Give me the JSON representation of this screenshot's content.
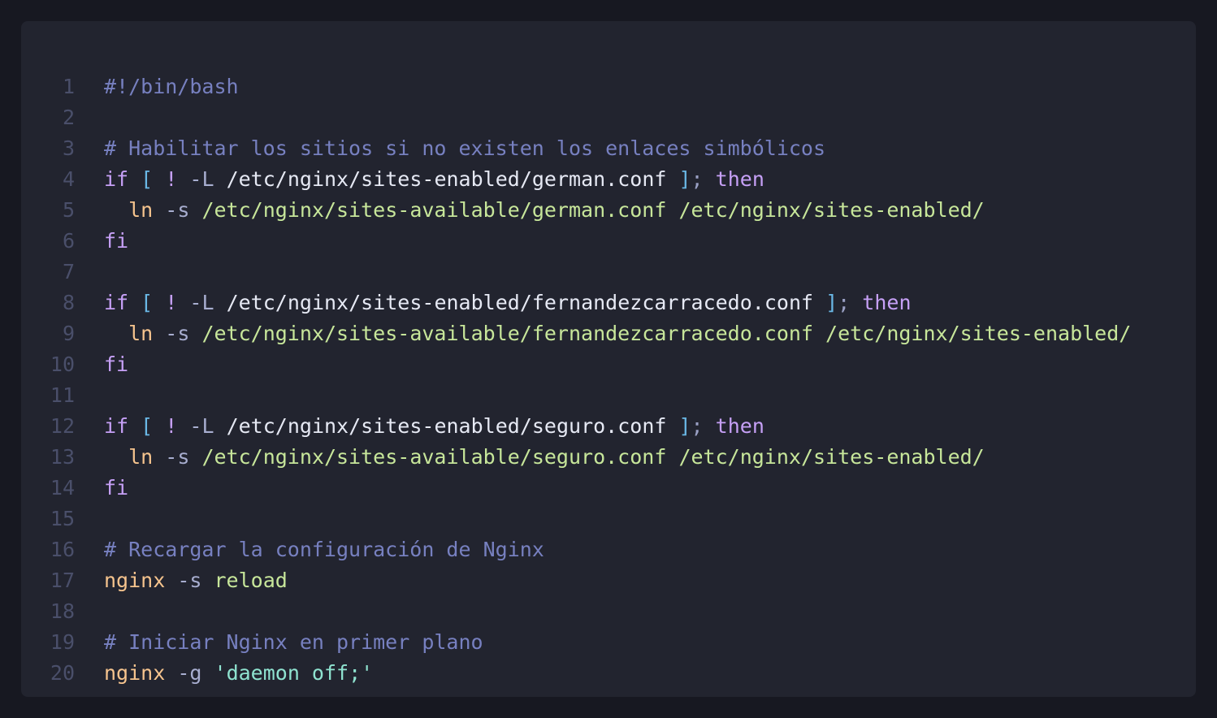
{
  "editor": {
    "language": "bash",
    "colors": {
      "background": "#22242f",
      "page": "#171821",
      "line_number": "#4a4f6a",
      "comment": "#7780c0",
      "keyword": "#c6a0f6",
      "bracket": "#6ab8e6",
      "command": "#f6c48e",
      "argument": "#c7e69a",
      "string": "#8fe3d0",
      "text": "#e6e9f4"
    },
    "lines": [
      {
        "n": "1",
        "tokens": [
          {
            "t": "#!/bin/bash",
            "c": "comment"
          }
        ]
      },
      {
        "n": "2",
        "tokens": []
      },
      {
        "n": "3",
        "tokens": [
          {
            "t": "# Habilitar los sitios si no existen los enlaces simbólicos",
            "c": "comment"
          }
        ]
      },
      {
        "n": "4",
        "tokens": [
          {
            "t": "if",
            "c": "keyword"
          },
          {
            "t": " ",
            "c": "path"
          },
          {
            "t": "[",
            "c": "bracket"
          },
          {
            "t": " ",
            "c": "path"
          },
          {
            "t": "!",
            "c": "keyword"
          },
          {
            "t": " ",
            "c": "path"
          },
          {
            "t": "-L",
            "c": "flag"
          },
          {
            "t": " /etc/nginx/sites-enabled/german.conf ",
            "c": "path"
          },
          {
            "t": "]",
            "c": "bracket"
          },
          {
            "t": ";",
            "c": "punct"
          },
          {
            "t": " ",
            "c": "path"
          },
          {
            "t": "then",
            "c": "keyword"
          }
        ]
      },
      {
        "n": "5",
        "tokens": [
          {
            "t": "  ",
            "c": "path"
          },
          {
            "t": "ln",
            "c": "cmd"
          },
          {
            "t": " ",
            "c": "path"
          },
          {
            "t": "-s",
            "c": "flag"
          },
          {
            "t": " /etc/nginx/sites-available/german.conf /etc/nginx/sites-enabled/",
            "c": "arg"
          }
        ]
      },
      {
        "n": "6",
        "tokens": [
          {
            "t": "fi",
            "c": "keyword"
          }
        ]
      },
      {
        "n": "7",
        "tokens": []
      },
      {
        "n": "8",
        "tokens": [
          {
            "t": "if",
            "c": "keyword"
          },
          {
            "t": " ",
            "c": "path"
          },
          {
            "t": "[",
            "c": "bracket"
          },
          {
            "t": " ",
            "c": "path"
          },
          {
            "t": "!",
            "c": "keyword"
          },
          {
            "t": " ",
            "c": "path"
          },
          {
            "t": "-L",
            "c": "flag"
          },
          {
            "t": " /etc/nginx/sites-enabled/fernandezcarracedo.conf ",
            "c": "path"
          },
          {
            "t": "]",
            "c": "bracket"
          },
          {
            "t": ";",
            "c": "punct"
          },
          {
            "t": " ",
            "c": "path"
          },
          {
            "t": "then",
            "c": "keyword"
          }
        ]
      },
      {
        "n": "9",
        "tokens": [
          {
            "t": "  ",
            "c": "path"
          },
          {
            "t": "ln",
            "c": "cmd"
          },
          {
            "t": " ",
            "c": "path"
          },
          {
            "t": "-s",
            "c": "flag"
          },
          {
            "t": " /etc/nginx/sites-available/fernandezcarracedo.conf /etc/nginx/sites-enabled/",
            "c": "arg"
          }
        ]
      },
      {
        "n": "10",
        "tokens": [
          {
            "t": "fi",
            "c": "keyword"
          }
        ]
      },
      {
        "n": "11",
        "tokens": []
      },
      {
        "n": "12",
        "tokens": [
          {
            "t": "if",
            "c": "keyword"
          },
          {
            "t": " ",
            "c": "path"
          },
          {
            "t": "[",
            "c": "bracket"
          },
          {
            "t": " ",
            "c": "path"
          },
          {
            "t": "!",
            "c": "keyword"
          },
          {
            "t": " ",
            "c": "path"
          },
          {
            "t": "-L",
            "c": "flag"
          },
          {
            "t": " /etc/nginx/sites-enabled/seguro.conf ",
            "c": "path"
          },
          {
            "t": "]",
            "c": "bracket"
          },
          {
            "t": ";",
            "c": "punct"
          },
          {
            "t": " ",
            "c": "path"
          },
          {
            "t": "then",
            "c": "keyword"
          }
        ]
      },
      {
        "n": "13",
        "tokens": [
          {
            "t": "  ",
            "c": "path"
          },
          {
            "t": "ln",
            "c": "cmd"
          },
          {
            "t": " ",
            "c": "path"
          },
          {
            "t": "-s",
            "c": "flag"
          },
          {
            "t": " /etc/nginx/sites-available/seguro.conf /etc/nginx/sites-enabled/",
            "c": "arg"
          }
        ]
      },
      {
        "n": "14",
        "tokens": [
          {
            "t": "fi",
            "c": "keyword"
          }
        ]
      },
      {
        "n": "15",
        "tokens": []
      },
      {
        "n": "16",
        "tokens": [
          {
            "t": "# Recargar la configuración de Nginx",
            "c": "comment"
          }
        ]
      },
      {
        "n": "17",
        "tokens": [
          {
            "t": "nginx",
            "c": "cmd"
          },
          {
            "t": " ",
            "c": "path"
          },
          {
            "t": "-s",
            "c": "flag"
          },
          {
            "t": " reload",
            "c": "arg"
          }
        ]
      },
      {
        "n": "18",
        "tokens": []
      },
      {
        "n": "19",
        "tokens": [
          {
            "t": "# Iniciar Nginx en primer plano",
            "c": "comment"
          }
        ]
      },
      {
        "n": "20",
        "tokens": [
          {
            "t": "nginx",
            "c": "cmd"
          },
          {
            "t": " ",
            "c": "path"
          },
          {
            "t": "-g",
            "c": "flag"
          },
          {
            "t": " ",
            "c": "path"
          },
          {
            "t": "'",
            "c": "str"
          },
          {
            "t": "daemon off;",
            "c": "str"
          },
          {
            "t": "'",
            "c": "str"
          }
        ]
      }
    ]
  }
}
